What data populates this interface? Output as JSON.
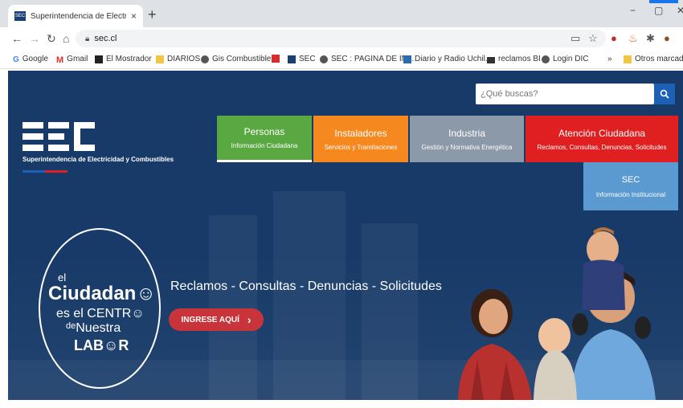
{
  "browser": {
    "tab_title": "Superintendencia de Electricidad",
    "tab_favicon": "SEC",
    "tab_close": "×",
    "new_tab": "+",
    "url": "sec.cl",
    "win_min": "−",
    "win_max": "▢",
    "win_close": "✕"
  },
  "bookmarks": [
    {
      "label": "Google",
      "icon": "google-icon",
      "color": "#4285f4"
    },
    {
      "label": "Gmail",
      "icon": "gmail-icon",
      "color": "#d93025"
    },
    {
      "label": "El Mostrador",
      "icon": "mostrador-icon",
      "color": "#222222"
    },
    {
      "label": "DIARIOS",
      "icon": "folder-icon",
      "color": "#f4c542"
    },
    {
      "label": "Gis Combustibles",
      "icon": "globe-icon",
      "color": "#555555"
    },
    {
      "label": "SEC",
      "icon": "sec-icon",
      "color": "#1b3f73"
    },
    {
      "label": "SEC : PAGINA DE IN...",
      "icon": "globe-icon",
      "color": "#555555"
    },
    {
      "label": "Diario y Radio Uchil...",
      "icon": "uchile-icon",
      "color": "#2b6cb0"
    },
    {
      "label": "reclamos BI",
      "icon": "chart-icon",
      "color": "#333333"
    },
    {
      "label": "Login DIC",
      "icon": "globe-icon",
      "color": "#555555"
    },
    {
      "label": "»",
      "icon": "more-icon",
      "color": "#555555"
    },
    {
      "label": "Otros marcadores",
      "icon": "folder-icon",
      "color": "#f4c542"
    }
  ],
  "site": {
    "search_placeholder": "¿Qué buscas?",
    "logo_text": "Superintendencia de Electricidad y Combustibles",
    "menu": [
      {
        "title": "Personas",
        "subtitle": "Información Ciudadana",
        "color": "#5aa842"
      },
      {
        "title": "Instaladores",
        "subtitle": "Servicios y Tramitaciones",
        "color": "#f5891f"
      },
      {
        "title": "Industria",
        "subtitle": "Gestión y Normativa Energética",
        "color": "#8c99a8"
      },
      {
        "title": "Atención Ciudadana",
        "subtitle": "Reclamos, Consultas, Denuncias, Solicitudes",
        "color": "#e02020"
      }
    ],
    "sec_box": {
      "title": "SEC",
      "subtitle": "Información Institucional"
    },
    "circle": {
      "el": "el",
      "ciudadano": "Ciudadan☺",
      "es_el_centro": "es el CENTR☺",
      "de": "de",
      "nuestra": "Nuestra",
      "labor": "LAB☺R"
    },
    "headline": "Reclamos - Consultas - Denuncias - Solicitudes",
    "cta_label": "INGRESE AQUÍ",
    "cta_arrow": "›"
  }
}
